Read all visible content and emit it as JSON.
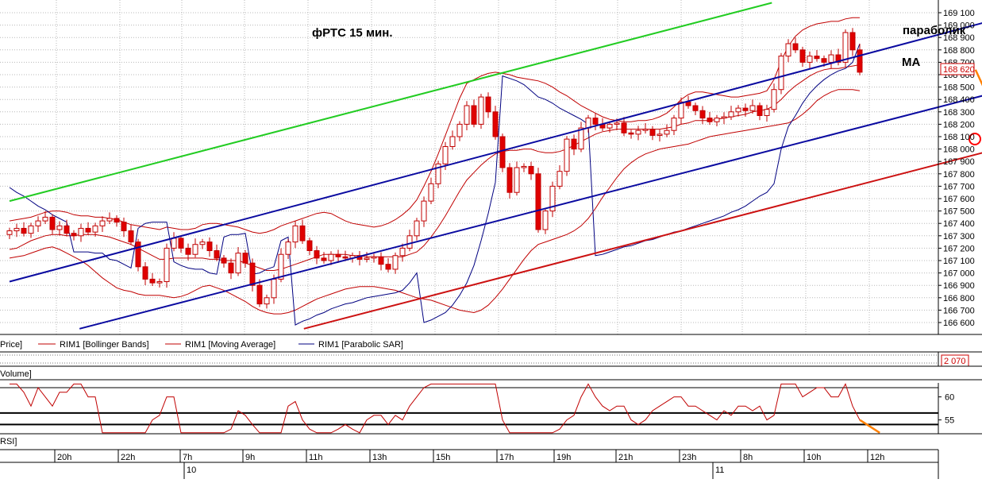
{
  "chart_data": [
    {
      "type": "candlestick",
      "panel": "price",
      "ylim": [
        166500,
        169150
      ],
      "y_ticks": [
        "169 100",
        "169 000",
        "168 900",
        "168 800",
        "168 700",
        "168 600",
        "168 500",
        "168 400",
        "168 300",
        "168 200",
        "168 100",
        "168 000",
        "167 900",
        "167 800",
        "167 700",
        "167 600",
        "167 500",
        "167 400",
        "167 300",
        "167 200",
        "167 100",
        "167 000",
        "166 900",
        "166 800",
        "166 700",
        "166 600"
      ],
      "last_price_label": "168 620",
      "grid": true,
      "annotations": {
        "title": "фРТС   15 мин.",
        "label_parabolic": "параболик",
        "label_ma": "МА"
      },
      "legend": {
        "price": "Price]",
        "bollinger": "RIM1 [Bollinger Bands]",
        "ma": "RIM1 [Moving Average]",
        "sar": "RIM1 [Parabolic SAR]"
      },
      "series": [
        {
          "name": "Price",
          "close": [
            167340,
            167360,
            167320,
            167380,
            167420,
            167450,
            167350,
            167380,
            167320,
            167300,
            167360,
            167330,
            167380,
            167420,
            167440,
            167410,
            167340,
            167250,
            167050,
            166950,
            166920,
            166930,
            167200,
            167280,
            167200,
            167150,
            167230,
            167250,
            167180,
            167120,
            167080,
            167000,
            167160,
            167080,
            166900,
            166750,
            166800,
            166950,
            167150,
            167250,
            167380,
            167260,
            167180,
            167120,
            167100,
            167150,
            167130,
            167120,
            167140,
            167110,
            167120,
            167130,
            167070,
            167030,
            167140,
            167200,
            167300,
            167420,
            167580,
            167720,
            167880,
            168020,
            168100,
            168200,
            168350,
            168200,
            168420,
            168300,
            168100,
            167850,
            167650,
            167850,
            167860,
            167800,
            167350,
            167500,
            167700,
            167820,
            168080,
            168000,
            168170,
            168250,
            168200,
            168170,
            168200,
            168210,
            168130,
            168120,
            168150,
            168160,
            168110,
            168120,
            168150,
            168250,
            168380,
            168350,
            168310,
            168250,
            168220,
            168250,
            168260,
            168300,
            168330,
            168310,
            168350,
            168270,
            168320,
            168480,
            168750,
            168850,
            168800,
            168700,
            168750,
            168730,
            168700,
            168760,
            168700,
            168940,
            168800,
            168620
          ]
        },
        {
          "name": "Bollinger upper",
          "values": [
            167420,
            167430,
            167440,
            167450,
            167470,
            167490,
            167500,
            167500,
            167490,
            167470,
            167460,
            167460,
            167450,
            167450,
            167440,
            167430,
            167410,
            167390,
            167380,
            167370,
            167360,
            167350,
            167370,
            167360,
            167350,
            167350,
            167360,
            167390,
            167400,
            167400,
            167390,
            167380,
            167370,
            167350,
            167330,
            167320,
            167330,
            167350,
            167380,
            167400,
            167420,
            167440,
            167460,
            167480,
            167490,
            167480,
            167450,
            167420,
            167400,
            167390,
            167380,
            167370,
            167380,
            167400,
            167430,
            167470,
            167520,
            167590,
            167700,
            167820,
            167960,
            168110,
            168260,
            168410,
            168530,
            168560,
            168590,
            168610,
            168620,
            168610,
            168600,
            168580,
            168570,
            168560,
            168550,
            168530,
            168500,
            168460,
            168430,
            168390,
            168350,
            168320,
            168290,
            168260,
            168240,
            168230,
            168220,
            168220,
            168230,
            168230,
            168240,
            168260,
            168290,
            168340,
            168400,
            168440,
            168460,
            168460,
            168450,
            168440,
            168430,
            168420,
            168420,
            168430,
            168440,
            168450,
            168470,
            168560,
            168710,
            168830,
            168910,
            168960,
            168990,
            169010,
            169020,
            169030,
            169030,
            169050,
            169060,
            169060
          ]
        },
        {
          "name": "Bollinger lower",
          "values": [
            167120,
            167130,
            167140,
            167160,
            167180,
            167200,
            167210,
            167190,
            167160,
            167130,
            167100,
            167060,
            167010,
            166960,
            166920,
            166880,
            166860,
            166850,
            166830,
            166820,
            166820,
            166820,
            166810,
            166800,
            166810,
            166830,
            166860,
            166890,
            166900,
            166880,
            166860,
            166830,
            166800,
            166770,
            166730,
            166700,
            166680,
            166670,
            166670,
            166680,
            166700,
            166730,
            166760,
            166790,
            166810,
            166830,
            166850,
            166870,
            166880,
            166890,
            166890,
            166890,
            166880,
            166870,
            166860,
            166840,
            166820,
            166800,
            166790,
            166780,
            166760,
            166740,
            166720,
            166700,
            166690,
            166680,
            166700,
            166740,
            166800,
            166870,
            166950,
            167030,
            167110,
            167180,
            167230,
            167250,
            167270,
            167290,
            167310,
            167340,
            167380,
            167440,
            167520,
            167610,
            167690,
            167770,
            167840,
            167890,
            167930,
            167960,
            167980,
            168000,
            168010,
            168020,
            168030,
            168040,
            168060,
            168080,
            168100,
            168110,
            168120,
            168130,
            168140,
            168150,
            168160,
            168170,
            168180,
            168190,
            168200,
            168210,
            168240,
            168280,
            168330,
            168390,
            168430,
            168460,
            168480,
            168480,
            168480,
            168470
          ]
        },
        {
          "name": "Moving Average",
          "values": [
            167190,
            167200,
            167230,
            167260,
            167280,
            167300,
            167310,
            167310,
            167300,
            167300,
            167310,
            167310,
            167310,
            167300,
            167290,
            167270,
            167250,
            167230,
            167200,
            167170,
            167140,
            167110,
            167110,
            167120,
            167120,
            167120,
            167120,
            167120,
            167110,
            167110,
            167100,
            167100,
            167100,
            167080,
            167060,
            167040,
            167020,
            167020,
            167030,
            167050,
            167070,
            167090,
            167110,
            167130,
            167150,
            167150,
            167150,
            167150,
            167140,
            167140,
            167130,
            167130,
            167130,
            167130,
            167130,
            167130,
            167150,
            167170,
            167220,
            167290,
            167370,
            167460,
            167560,
            167660,
            167750,
            167810,
            167870,
            167920,
            167960,
            167980,
            167990,
            167990,
            168000,
            168000,
            167980,
            167970,
            167970,
            167980,
            168000,
            168030,
            168060,
            168090,
            168120,
            168140,
            168150,
            168160,
            168160,
            168160,
            168160,
            168160,
            168160,
            168160,
            168170,
            168180,
            168200,
            168210,
            168230,
            168230,
            168230,
            168240,
            168250,
            168260,
            168270,
            168280,
            168300,
            168310,
            168320,
            168350,
            168400,
            168460,
            168510,
            168550,
            168590,
            168620,
            168640,
            168650,
            168650,
            168660,
            168670,
            168680
          ]
        },
        {
          "name": "Parabolic SAR",
          "values": [
            167690,
            167650,
            167620,
            167580,
            167540,
            167510,
            167470,
            167440,
            167410,
            167170,
            167170,
            167170,
            167160,
            167160,
            167110,
            167100,
            167070,
            167040,
            167360,
            167400,
            167410,
            167410,
            167410,
            167090,
            167060,
            167040,
            167030,
            167030,
            167000,
            166990,
            167290,
            167310,
            167310,
            167320,
            166990,
            167000,
            167030,
            167050,
            167260,
            167290,
            166580,
            166610,
            166630,
            166660,
            166680,
            166710,
            166730,
            166750,
            166760,
            166780,
            166800,
            166810,
            166820,
            166830,
            166840,
            166860,
            166920,
            167000,
            166600,
            166620,
            166650,
            166680,
            166740,
            166820,
            166920,
            167060,
            167260,
            167480,
            167730,
            168590,
            168570,
            168550,
            168520,
            168470,
            168420,
            168400,
            168370,
            168330,
            168300,
            168270,
            168240,
            168200,
            167140,
            167150,
            167170,
            167190,
            167210,
            167220,
            167240,
            167260,
            167270,
            167290,
            167310,
            167330,
            167340,
            167360,
            167380,
            167400,
            167420,
            167440,
            167460,
            167490,
            167510,
            167540,
            167580,
            167620,
            167650,
            167720,
            168000,
            168180,
            168270,
            168370,
            168450,
            168510,
            168560,
            168600,
            168630,
            168650,
            168700,
            168850
          ]
        }
      ],
      "trendlines": [
        {
          "name": "green",
          "x": [
            0,
            106.7
          ],
          "y": [
            167580,
            169180
          ]
        },
        {
          "name": "blue-upper",
          "x": [
            0,
            142.9
          ],
          "y": [
            166930,
            169120
          ]
        },
        {
          "name": "blue-lower",
          "x": [
            9.8,
            142.9
          ],
          "y": [
            166550,
            168530
          ]
        },
        {
          "name": "red",
          "x": [
            41.2,
            142.9
          ],
          "y": [
            166550,
            168070
          ]
        },
        {
          "name": "orange-arrow",
          "x": [
            135.2,
            147.6
          ],
          "y": [
            168640,
            167100
          ]
        }
      ],
      "colors": {
        "up_candle": "#ffffff",
        "down_candle": "#e00000",
        "bollinger": "#c00000",
        "ma": "#c00000",
        "sar": "#000080",
        "trend_green": "#22cc22",
        "trend_blue": "#0a0aa0",
        "trend_red": "#cc1111",
        "arrow": "#ff8000",
        "marker": "#ff0000"
      }
    },
    {
      "type": "bar",
      "panel": "volume",
      "legend": "Volume]",
      "last_value_label": "2 070"
    },
    {
      "type": "line",
      "panel": "rsi",
      "legend": "RSI]",
      "ylim": [
        52,
        62
      ],
      "y_ticks": [
        "60",
        "55"
      ],
      "levels": [
        56.5,
        54.0
      ],
      "series": [
        {
          "name": "RSI",
          "values": [
            63,
            63,
            61,
            58,
            62,
            60,
            58,
            61,
            61,
            64,
            63,
            60,
            60,
            50,
            50,
            50,
            50,
            50,
            50,
            50,
            55,
            56,
            60,
            60,
            50,
            50,
            51,
            52,
            50,
            51,
            52,
            53,
            57,
            56,
            54,
            50,
            50,
            50,
            50,
            58,
            59,
            55,
            53,
            50,
            50,
            51,
            53,
            54,
            53,
            52,
            55,
            56,
            56,
            54,
            56,
            55,
            58,
            60,
            62,
            63,
            64,
            65,
            64,
            66,
            67,
            66,
            68,
            69,
            65,
            55,
            50,
            50,
            50,
            51,
            52,
            50,
            51,
            53,
            55,
            56,
            60,
            63,
            60,
            58,
            57,
            58,
            58,
            55,
            54,
            55,
            57,
            58,
            59,
            60,
            60,
            58,
            58,
            57,
            56,
            55,
            57,
            56,
            58,
            58,
            57,
            58,
            55,
            56,
            64,
            66,
            64,
            60,
            61,
            62,
            62,
            60,
            60,
            63,
            58,
            55
          ]
        },
        {
          "name": "RSI projection",
          "x": [
            119,
            121.8
          ],
          "values": [
            55,
            52.2
          ]
        }
      ]
    },
    {
      "type": "axis",
      "panel": "time",
      "hour_labels": [
        "20h",
        "22h",
        "7h",
        "9h",
        "11h",
        "13h",
        "15h",
        "17h",
        "19h",
        "21h",
        "23h",
        "8h",
        "10h",
        "12h"
      ],
      "day_labels": [
        "10",
        "11"
      ]
    }
  ]
}
